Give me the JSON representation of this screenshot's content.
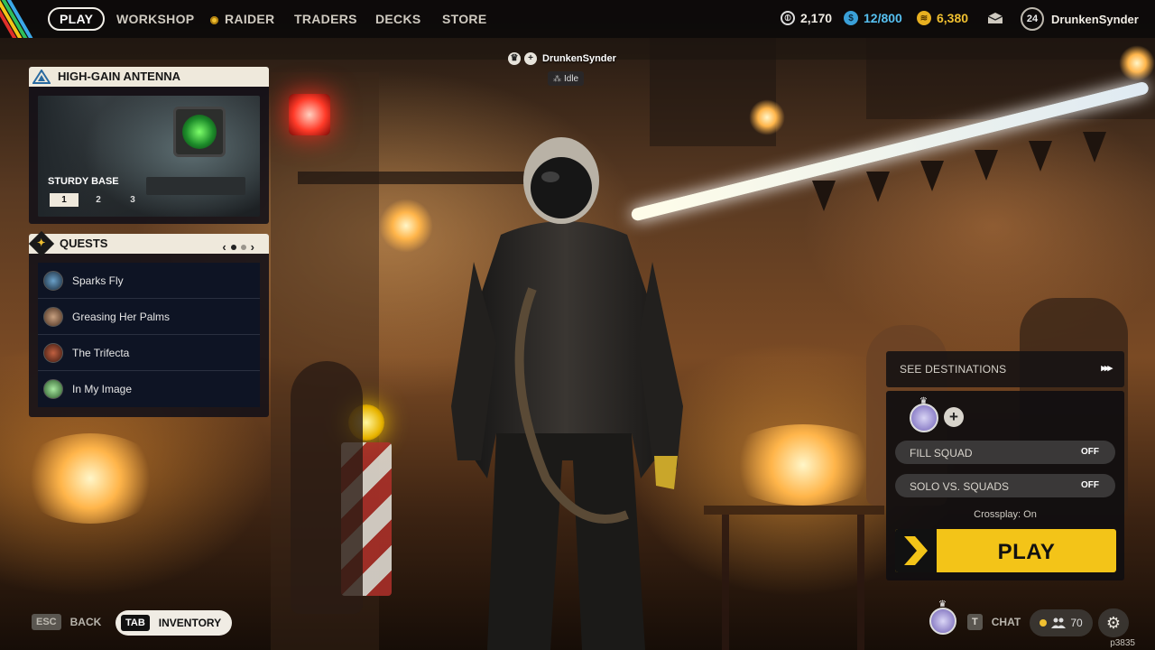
{
  "nav": {
    "items": [
      "PLAY",
      "WORKSHOP",
      "RAIDER",
      "TRADERS",
      "DECKS",
      "STORE"
    ],
    "active": "PLAY"
  },
  "currencies": [
    {
      "icon": "cred-icon",
      "value": "2,170"
    },
    {
      "icon": "token-icon",
      "value": "12/800"
    },
    {
      "icon": "coins-icon",
      "value": "6,380"
    }
  ],
  "user": {
    "level": "24",
    "name": "DrunkenSynder"
  },
  "player_tag": {
    "name": "DrunkenSynder",
    "status": "Idle"
  },
  "antenna": {
    "title": "HIGH-GAIN ANTENNA",
    "subtitle": "STURDY BASE",
    "tiers": [
      "1",
      "2",
      "3"
    ],
    "active_tier": "1"
  },
  "quests": {
    "title": "QUESTS",
    "page": 1,
    "pages": 2,
    "items": [
      {
        "name": "Sparks Fly"
      },
      {
        "name": "Greasing Her Palms"
      },
      {
        "name": "The Trifecta"
      },
      {
        "name": "In My Image"
      }
    ]
  },
  "matchmaking": {
    "destinations_label": "SEE DESTINATIONS",
    "fill_squad": {
      "label": "FILL SQUAD",
      "value": "OFF"
    },
    "solo_vs_squads": {
      "label": "SOLO VS. SQUADS",
      "value": "OFF"
    },
    "crossplay": "Crossplay: On",
    "play_label": "PLAY"
  },
  "bottom": {
    "esc_key": "ESC",
    "back_label": "BACK",
    "tab_key": "TAB",
    "inventory_label": "INVENTORY",
    "chat_key": "T",
    "chat_label": "CHAT",
    "friends_count": "70",
    "build_id": "p3835"
  },
  "colors": {
    "accent": "#f3c418",
    "panel_header": "#efe9dc",
    "quest_bg": "#0e1424"
  }
}
